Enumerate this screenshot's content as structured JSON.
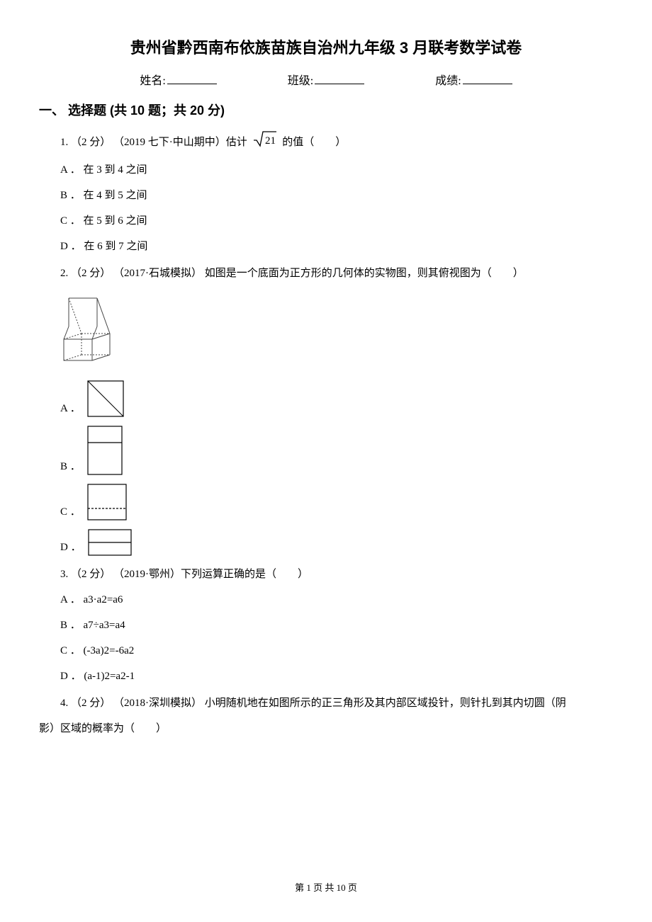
{
  "title": "贵州省黔西南布依族苗族自治州九年级 3 月联考数学试卷",
  "info": {
    "name_label": "姓名:",
    "class_label": "班级:",
    "score_label": "成绩:"
  },
  "section1": {
    "header": "一、 选择题 (共 10 题；共 20 分)"
  },
  "q1": {
    "stem_prefix": "1.  （2 分） （2019 七下·中山期中）估计",
    "sqrt_val": "21",
    "stem_suffix": "的值（  ）",
    "A": "A ． 在 3 到 4 之间",
    "B": "B ． 在 4 到 5 之间",
    "C": "C ． 在 5 到 6 之间",
    "D": "D ． 在 6 到 7 之间"
  },
  "q2": {
    "stem": "2.  （2 分） （2017·石城模拟） 如图是一个底面为正方形的几何体的实物图，则其俯视图为（  ）",
    "A": "A ．",
    "B": "B ．",
    "C": "C ．",
    "D": "D ．"
  },
  "q3": {
    "stem": "3.  （2 分） （2019·鄂州）下列运算正确的是（  ）",
    "A": "A ． a3·a2=a6",
    "B": "B ． a7÷a3=a4",
    "C": "C ． (-3a)2=-6a2",
    "D": "D ． (a-1)2=a2-1"
  },
  "q4": {
    "line1": "4.  （2 分） （2018·深圳模拟） 小明随机地在如图所示的正三角形及其内部区域投针，则针扎到其内切圆（阴",
    "line2": "影）区域的概率为（  ）"
  },
  "footer": "第 1 页 共 10 页"
}
